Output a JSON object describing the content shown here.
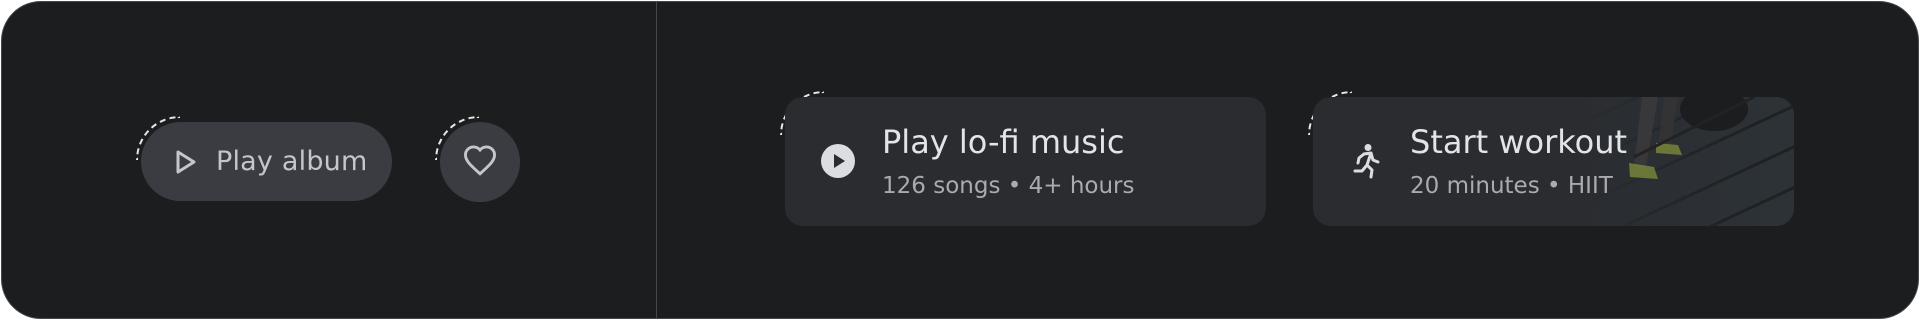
{
  "left_panel": {
    "play_button": {
      "label": "Play album",
      "icon": "play-outline-icon"
    },
    "favorite_button": {
      "icon": "heart-outline-icon"
    }
  },
  "cards": {
    "music": {
      "title": "Play lo-fi music",
      "subtitle": "126 songs • 4+ hours",
      "icon": "play-circle-icon"
    },
    "workout": {
      "title": "Start workout",
      "subtitle": "20 minutes • HIIT",
      "icon": "running-figure-icon"
    }
  },
  "colors": {
    "background": "#1c1d1f",
    "button": "#3a3c42",
    "card": "#2a2c30",
    "text_primary": "#e3e4e8",
    "text_secondary": "#a9abb1",
    "focus_ring": "#e8e8ea"
  }
}
